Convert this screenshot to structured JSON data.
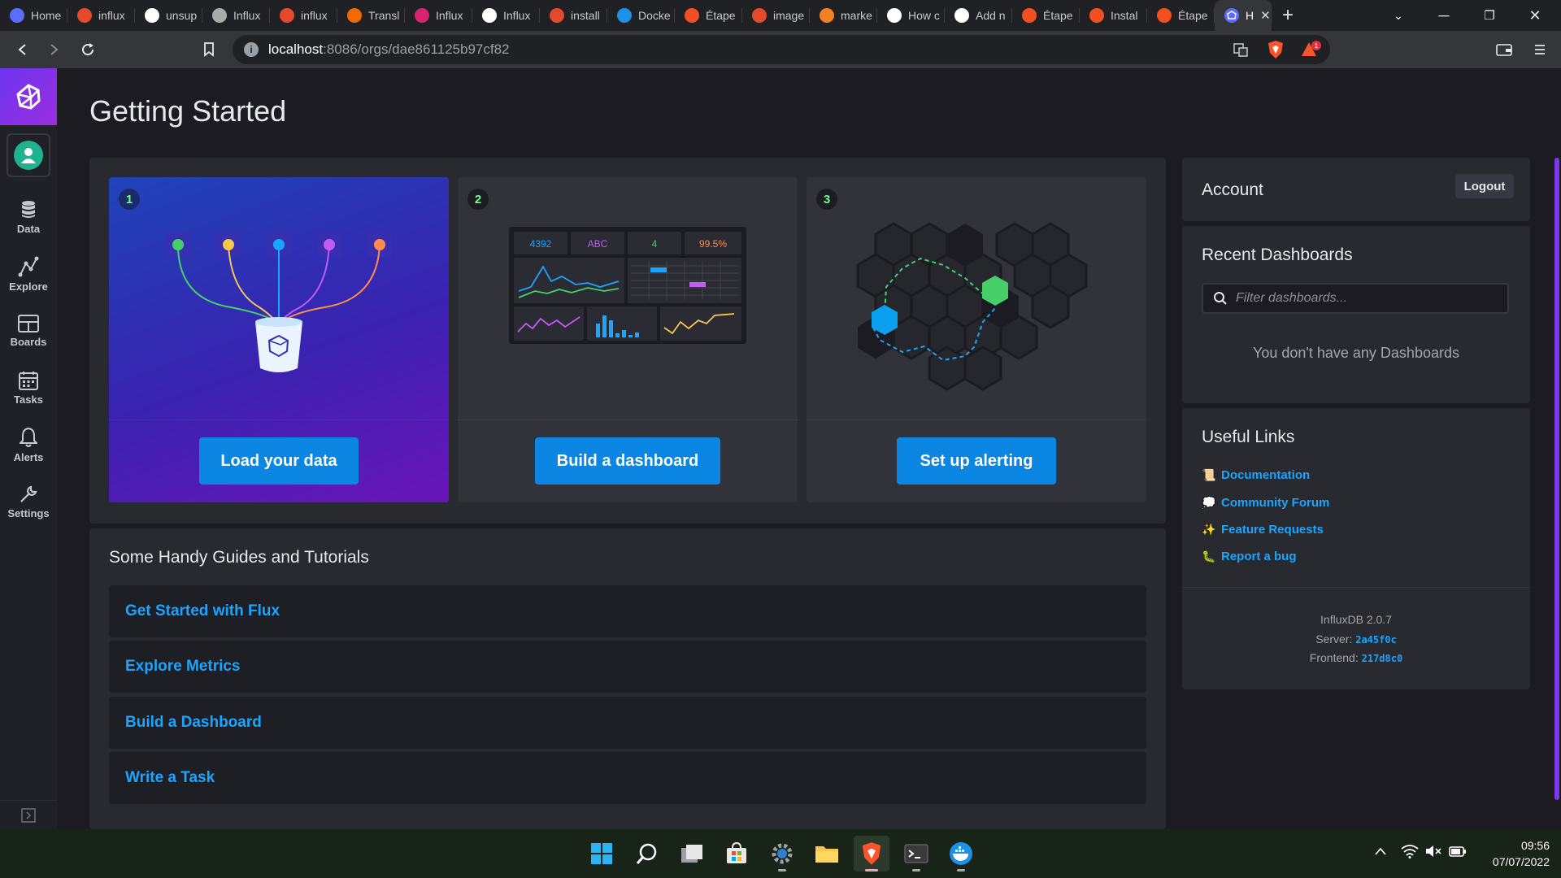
{
  "browser": {
    "tabs": [
      {
        "label": "Home",
        "icon": "influx-icon",
        "color": "#5b6cff"
      },
      {
        "label": "influx",
        "icon": "brave-icon",
        "color": "#e24a2b"
      },
      {
        "label": "unsup",
        "icon": "github-icon",
        "color": "#ffffff"
      },
      {
        "label": "Influx",
        "icon": "globe-icon",
        "color": "#aaaaaa"
      },
      {
        "label": "influx",
        "icon": "brave-icon",
        "color": "#e24a2b"
      },
      {
        "label": "Transl",
        "icon": "grafana-icon",
        "color": "#f46800"
      },
      {
        "label": "Influx",
        "icon": "influx-icon",
        "color": "#d6246e"
      },
      {
        "label": "Influx",
        "icon": "github-icon",
        "color": "#ffffff"
      },
      {
        "label": "install",
        "icon": "brave-icon",
        "color": "#e24a2b"
      },
      {
        "label": "Docke",
        "icon": "docker-icon",
        "color": "#1d91e6"
      },
      {
        "label": "Étape",
        "icon": "windows-icon",
        "color": "#f25022"
      },
      {
        "label": "image",
        "icon": "brave-icon",
        "color": "#e24a2b"
      },
      {
        "label": "marke",
        "icon": "stackoverflow-icon",
        "color": "#f48024"
      },
      {
        "label": "How c",
        "icon": "github-icon",
        "color": "#ffffff"
      },
      {
        "label": "Add n",
        "icon": "doc-icon",
        "color": "#ffffff"
      },
      {
        "label": "Étape",
        "icon": "windows-icon",
        "color": "#f25022"
      },
      {
        "label": "Instal",
        "icon": "windows-icon",
        "color": "#f25022"
      },
      {
        "label": "Étape",
        "icon": "windows-icon",
        "color": "#f25022"
      }
    ],
    "active_tab": {
      "label": "H",
      "icon": "influx-icon"
    },
    "url_host": "localhost",
    "url_rest": ":8086/orgs/dae861125b97cf82",
    "shield_badge": "1"
  },
  "nav": {
    "items": [
      {
        "label": "Data",
        "icon": "database-icon"
      },
      {
        "label": "Explore",
        "icon": "graph-icon"
      },
      {
        "label": "Boards",
        "icon": "dashboard-icon"
      },
      {
        "label": "Tasks",
        "icon": "calendar-icon"
      },
      {
        "label": "Alerts",
        "icon": "bell-icon"
      },
      {
        "label": "Settings",
        "icon": "wrench-icon"
      }
    ]
  },
  "page": {
    "title": "Getting Started"
  },
  "cards": [
    {
      "number": "1",
      "cta": "Load your data"
    },
    {
      "number": "2",
      "cta": "Build a dashboard",
      "stats": [
        "4392",
        "ABC",
        "4",
        "99.5%"
      ]
    },
    {
      "number": "3",
      "cta": "Set up alerting"
    }
  ],
  "guides": {
    "heading": "Some Handy Guides and Tutorials",
    "items": [
      "Get Started with Flux",
      "Explore Metrics",
      "Build a Dashboard",
      "Write a Task"
    ]
  },
  "account": {
    "title": "Account",
    "logout_label": "Logout"
  },
  "recent_dashboards": {
    "title": "Recent Dashboards",
    "filter_placeholder": "Filter dashboards...",
    "empty_message": "You don't have any Dashboards"
  },
  "useful_links": {
    "title": "Useful Links",
    "links": [
      {
        "label": "Documentation",
        "emoji": "📜"
      },
      {
        "label": "Community Forum",
        "emoji": "💭"
      },
      {
        "label": "Feature Requests",
        "emoji": "✨"
      },
      {
        "label": "Report a bug",
        "emoji": "🐛"
      }
    ],
    "version_label": "InfluxDB 2.0.7",
    "server_label": "Server:",
    "server_value": "2a45f0c",
    "frontend_label": "Frontend:",
    "frontend_value": "217d8c0"
  },
  "taskbar": {
    "time": "09:56",
    "date": "07/07/2022"
  }
}
